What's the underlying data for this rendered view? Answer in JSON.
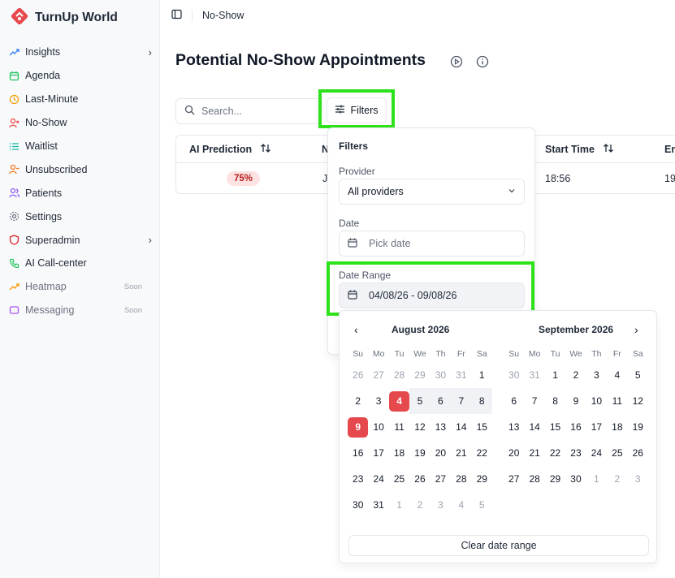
{
  "app": {
    "name": "TurnUp World",
    "brand_color": "#e5484d",
    "highlight_color": "#2ee21b"
  },
  "sidebar": {
    "items": [
      {
        "label": "Insights",
        "icon": "trend-up-icon",
        "color": "#3b82f6",
        "has_chevron": true
      },
      {
        "label": "Agenda",
        "icon": "calendar-icon",
        "color": "#22c55e"
      },
      {
        "label": "Last-Minute",
        "icon": "clock-icon",
        "color": "#f59e0b"
      },
      {
        "label": "No-Show",
        "icon": "user-x-icon",
        "color": "#ef4444"
      },
      {
        "label": "Waitlist",
        "icon": "list-icon",
        "color": "#14b8a6"
      },
      {
        "label": "Unsubscribed",
        "icon": "user-minus-icon",
        "color": "#f97316"
      },
      {
        "label": "Patients",
        "icon": "users-icon",
        "color": "#8b5cf6"
      },
      {
        "label": "Settings",
        "icon": "gear-icon",
        "color": "#6b7280"
      },
      {
        "label": "Superadmin",
        "icon": "shield-icon",
        "color": "#dc2626",
        "has_chevron": true
      },
      {
        "label": "AI Call-center",
        "icon": "phone-icon",
        "color": "#22c55e"
      },
      {
        "label": "Heatmap",
        "icon": "trend-up-icon",
        "color": "#f59e0b",
        "badge": "Soon"
      },
      {
        "label": "Messaging",
        "icon": "message-icon",
        "color": "#a855f7",
        "badge": "Soon"
      }
    ]
  },
  "topbar": {
    "breadcrumb": "No-Show"
  },
  "page": {
    "title": "Potential No-Show Appointments"
  },
  "search": {
    "placeholder": "Search..."
  },
  "toolbar": {
    "filters_label": "Filters"
  },
  "table": {
    "columns": [
      "AI Prediction",
      "N",
      "Start Time",
      "En"
    ],
    "row": {
      "prediction": "75%",
      "name": "J",
      "start_time": "18:56",
      "end_time": "19:"
    }
  },
  "filters": {
    "title": "Filters",
    "provider_label": "Provider",
    "provider_value": "All providers",
    "date_label": "Date",
    "date_placeholder": "Pick date",
    "range_label": "Date Range",
    "range_value": "04/08/26 - 09/08/26"
  },
  "calendar": {
    "weekdays": [
      "Su",
      "Mo",
      "Tu",
      "We",
      "Th",
      "Fr",
      "Sa"
    ],
    "months": [
      {
        "title": "August 2026",
        "weeks": [
          [
            "26",
            "27",
            "28",
            "29",
            "30",
            "31",
            "1"
          ],
          [
            "2",
            "3",
            "4",
            "5",
            "6",
            "7",
            "8"
          ],
          [
            "9",
            "10",
            "11",
            "12",
            "13",
            "14",
            "15"
          ],
          [
            "16",
            "17",
            "18",
            "19",
            "20",
            "21",
            "22"
          ],
          [
            "23",
            "24",
            "25",
            "26",
            "27",
            "28",
            "29"
          ],
          [
            "30",
            "31",
            "1",
            "2",
            "3",
            "4",
            "5"
          ]
        ]
      },
      {
        "title": "September 2026",
        "weeks": [
          [
            "30",
            "31",
            "1",
            "2",
            "3",
            "4",
            "5"
          ],
          [
            "6",
            "7",
            "8",
            "9",
            "10",
            "11",
            "12"
          ],
          [
            "13",
            "14",
            "15",
            "16",
            "17",
            "18",
            "19"
          ],
          [
            "20",
            "21",
            "22",
            "23",
            "24",
            "25",
            "26"
          ],
          [
            "27",
            "28",
            "29",
            "30",
            "1",
            "2",
            "3"
          ]
        ]
      }
    ],
    "selected_start": "4",
    "selected_end": "9",
    "clear_label": "Clear date range"
  }
}
